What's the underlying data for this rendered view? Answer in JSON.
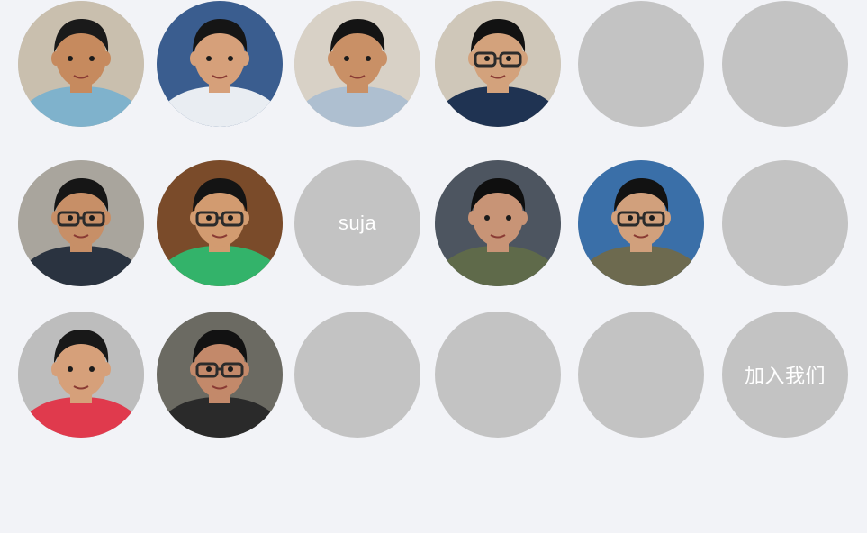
{
  "grid": {
    "rows": [
      [
        {
          "type": "photo",
          "bg": "#c9bfae",
          "shirt": "#7fb2cc",
          "skin": "#c68a5e",
          "hair": "#1a1a1a",
          "glasses": false
        },
        {
          "type": "photo",
          "bg": "#3a5d8f",
          "shirt": "#e9edf2",
          "skin": "#d6a07a",
          "hair": "#151515",
          "glasses": false
        },
        {
          "type": "photo",
          "bg": "#d8d1c6",
          "shirt": "#aebfd0",
          "skin": "#c99066",
          "hair": "#141414",
          "glasses": false
        },
        {
          "type": "photo",
          "bg": "#cfc7b9",
          "shirt": "#1f3352",
          "skin": "#d3a27c",
          "hair": "#121212",
          "glasses": true
        },
        {
          "type": "empty",
          "text": ""
        },
        {
          "type": "empty",
          "text": ""
        }
      ],
      [
        {
          "type": "photo",
          "bg": "#a9a59d",
          "shirt": "#2a3340",
          "skin": "#c78f67",
          "hair": "#161616",
          "glasses": true
        },
        {
          "type": "photo",
          "bg": "#7a4b2a",
          "shirt": "#33b36a",
          "skin": "#d29b70",
          "hair": "#141414",
          "glasses": true
        },
        {
          "type": "text",
          "text": "suja"
        },
        {
          "type": "photo",
          "bg": "#4d5560",
          "shirt": "#5f6a4a",
          "skin": "#c89476",
          "hair": "#0f0f0f",
          "glasses": false
        },
        {
          "type": "photo",
          "bg": "#3a6fa8",
          "shirt": "#6d6a4f",
          "skin": "#d1a07c",
          "hair": "#121212",
          "glasses": true
        },
        {
          "type": "empty",
          "text": ""
        }
      ],
      [
        {
          "type": "photo",
          "bg": "#bdbdbd",
          "shirt": "#e03a4d",
          "skin": "#d6a07a",
          "hair": "#181818",
          "glasses": false
        },
        {
          "type": "photo",
          "bg": "#6b6a62",
          "shirt": "#2a2a2a",
          "skin": "#c3896a",
          "hair": "#121212",
          "glasses": true
        },
        {
          "type": "empty",
          "text": ""
        },
        {
          "type": "empty",
          "text": ""
        },
        {
          "type": "empty",
          "text": ""
        },
        {
          "type": "text",
          "text": "加入我们"
        }
      ]
    ]
  }
}
